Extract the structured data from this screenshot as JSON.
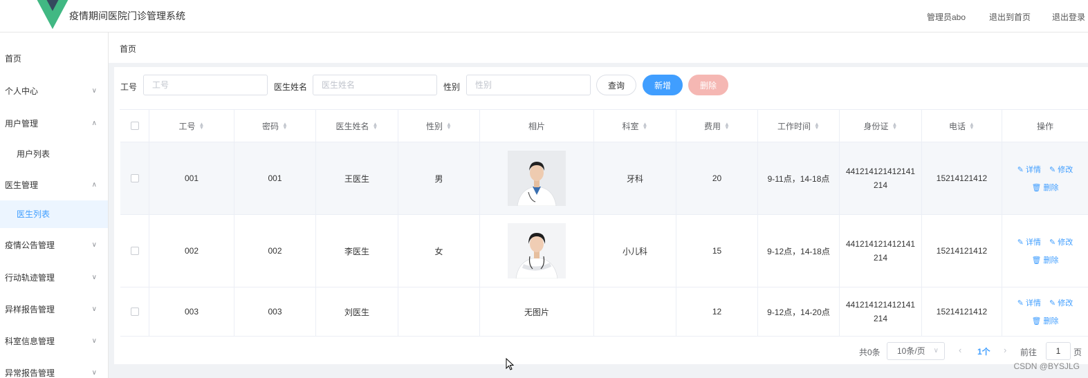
{
  "header": {
    "title": "疫情期间医院门诊管理系统",
    "user": "管理员abo",
    "back_home": "退出到首页",
    "logout": "退出登录",
    "logo_colors": [
      "#41b883",
      "#34495e"
    ]
  },
  "sidebar": {
    "items": [
      {
        "label": "首页",
        "chevron": ""
      },
      {
        "label": "个人中心",
        "chevron": "∨"
      },
      {
        "label": "用户管理",
        "chevron": "∧"
      },
      {
        "label": "用户列表",
        "chevron": ""
      },
      {
        "label": "医生管理",
        "chevron": "∧"
      },
      {
        "label": "医生列表",
        "chevron": ""
      },
      {
        "label": "疫情公告管理",
        "chevron": "∨"
      },
      {
        "label": "行动轨迹管理",
        "chevron": "∨"
      },
      {
        "label": "异样报告管理",
        "chevron": "∨"
      },
      {
        "label": "科室信息管理",
        "chevron": "∨"
      },
      {
        "label": "异常报告管理",
        "chevron": "∨"
      }
    ]
  },
  "breadcrumb": "首页",
  "search": {
    "id_label": "工号",
    "id_placeholder": "工号",
    "name_label": "医生姓名",
    "name_placeholder": "医生姓名",
    "gender_label": "性别",
    "gender_placeholder": "性别",
    "query": "查询",
    "add": "新增",
    "delete": "删除"
  },
  "table": {
    "headers": [
      "工号",
      "密码",
      "医生姓名",
      "性别",
      "相片",
      "科室",
      "费用",
      "工作时间",
      "身份证",
      "电话",
      "操作"
    ],
    "rows": [
      {
        "id": "001",
        "password": "001",
        "name": "王医生",
        "gender": "男",
        "photo": "",
        "dept": "牙科",
        "fee": "20",
        "hours": "9-11点，14-18点",
        "idcard": "441214121412141214",
        "phone": "15214121412"
      },
      {
        "id": "002",
        "password": "002",
        "name": "李医生",
        "gender": "女",
        "photo": "",
        "dept": "小儿科",
        "fee": "15",
        "hours": "9-12点，14-18点",
        "idcard": "441214121412141214",
        "phone": "15214121412"
      },
      {
        "id": "003",
        "password": "003",
        "name": "刘医生",
        "gender": "",
        "photo": "无图片",
        "dept": "",
        "fee": "12",
        "hours": "9-12点，14-20点",
        "idcard": "441214121412141214",
        "phone": "15214121412"
      }
    ],
    "ops": {
      "detail": "详情",
      "edit": "修改",
      "delete": "删除"
    }
  },
  "pagination": {
    "total": "共0条",
    "page_size": "10条/页",
    "current": "1个",
    "goto": "前往",
    "page_value": "1",
    "page_unit": "页"
  },
  "watermark": "CSDN @BYSJLG"
}
